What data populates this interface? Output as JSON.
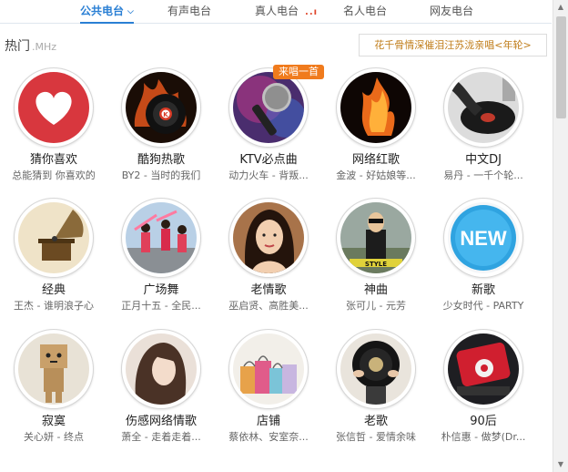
{
  "tabs": [
    {
      "label": "公共电台"
    },
    {
      "label": "有声电台"
    },
    {
      "label": "真人电台"
    },
    {
      "label": "名人电台"
    },
    {
      "label": "网友电台"
    }
  ],
  "section": {
    "title": "热门",
    "unit": ".MHz"
  },
  "promo": "花千骨情深催泪汪苏泷亲唱<年轮>",
  "badge": "来唱一首",
  "stations": [
    {
      "name": "猜你喜欢",
      "sub": "总能猜到 你喜欢的",
      "icon": "heart-icon"
    },
    {
      "name": "酷狗热歌",
      "sub": "BY2 - 当时的我们",
      "icon": "flaming-record-icon"
    },
    {
      "name": "KTV必点曲",
      "sub": "动力火车 - 背叛...",
      "icon": "microphone-icon"
    },
    {
      "name": "网络红歌",
      "sub": "金波 - 好姑娘等...",
      "icon": "flaming-clef-icon"
    },
    {
      "name": "中文DJ",
      "sub": "易丹 - 一千个轮...",
      "icon": "dj-turntable-icon"
    },
    {
      "name": "经典",
      "sub": "王杰 - 谁明浪子心",
      "icon": "gramophone-icon"
    },
    {
      "name": "广场舞",
      "sub": "正月十五 - 全民...",
      "icon": "dancers-photo"
    },
    {
      "name": "老情歌",
      "sub": "巫启贤、高胜美...",
      "icon": "singer-portrait"
    },
    {
      "name": "神曲",
      "sub": "张可儿 - 元芳",
      "icon": "psy-photo"
    },
    {
      "name": "新歌",
      "sub": "少女时代 - PARTY",
      "icon": "new-badge-icon"
    },
    {
      "name": "寂寞",
      "sub": "关心妍 - 终点",
      "icon": "cardboard-robot-photo"
    },
    {
      "name": "伤感网络情歌",
      "sub": "萧全 - 走着走着...",
      "icon": "girl-portrait"
    },
    {
      "name": "店铺",
      "sub": "蔡依林、安室奈...",
      "icon": "shopping-bags-photo"
    },
    {
      "name": "老歌",
      "sub": "张信哲 - 爱情余味",
      "icon": "vinyl-record-photo"
    },
    {
      "name": "90后",
      "sub": "朴信惠 - 做梦(Dr...",
      "icon": "red-ipod-icon"
    }
  ],
  "colors": {
    "accent": "#2a7fd4",
    "badge": "#f07b1d",
    "promo_text": "#c07d1a"
  }
}
